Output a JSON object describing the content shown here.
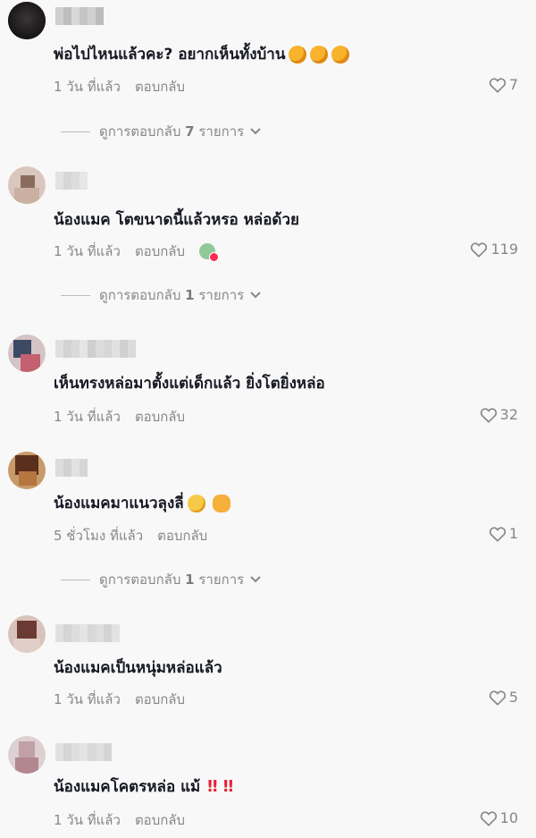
{
  "comments": [
    {
      "text": "พ่อไปไหนแล้วคะ? อยากเห็นทั้งบ้าน",
      "emoji": [
        "laughing-face-icon",
        "laughing-face-icon",
        "laughing-face-icon"
      ],
      "time": "1 วัน ที่แล้ว",
      "reply": "ตอบกลับ",
      "likes": "7",
      "view_replies": {
        "prefix": "ดูการตอบกลับ",
        "count": "7",
        "suffix": "รายการ"
      }
    },
    {
      "text": "น้องแมค โตขนาดนี้แล้วหรอ หล่อด้วย",
      "time": "1 วัน ที่แล้ว",
      "reply": "ตอบกลับ",
      "creator_liked": true,
      "likes": "119",
      "view_replies": {
        "prefix": "ดูการตอบกลับ",
        "count": "1",
        "suffix": "รายการ"
      }
    },
    {
      "text": "เห็นทรงหล่อมาตั้งแต่เด็กแล้ว ยิ่งโตยิ่งหล่อ",
      "time": "1 วัน ที่แล้ว",
      "reply": "ตอบกลับ",
      "likes": "32"
    },
    {
      "text": "น้องแมคมาแนวลุงลี่",
      "emoji": [
        "grinning-face-icon",
        "smiling-face-hearts-icon"
      ],
      "time": "5 ชั่วโมง ที่แล้ว",
      "reply": "ตอบกลับ",
      "likes": "1",
      "view_replies": {
        "prefix": "ดูการตอบกลับ",
        "count": "1",
        "suffix": "รายการ"
      }
    },
    {
      "text": "น้องแมคเป็นหนุ่มหล่อแล้ว",
      "time": "1 วัน ที่แล้ว",
      "reply": "ตอบกลับ",
      "likes": "5"
    },
    {
      "text": "น้องแมคโคตรหล่อ แม้",
      "marks": "‼ ‼",
      "time": "1 วัน ที่แล้ว",
      "reply": "ตอบกลับ",
      "likes": "10"
    }
  ]
}
